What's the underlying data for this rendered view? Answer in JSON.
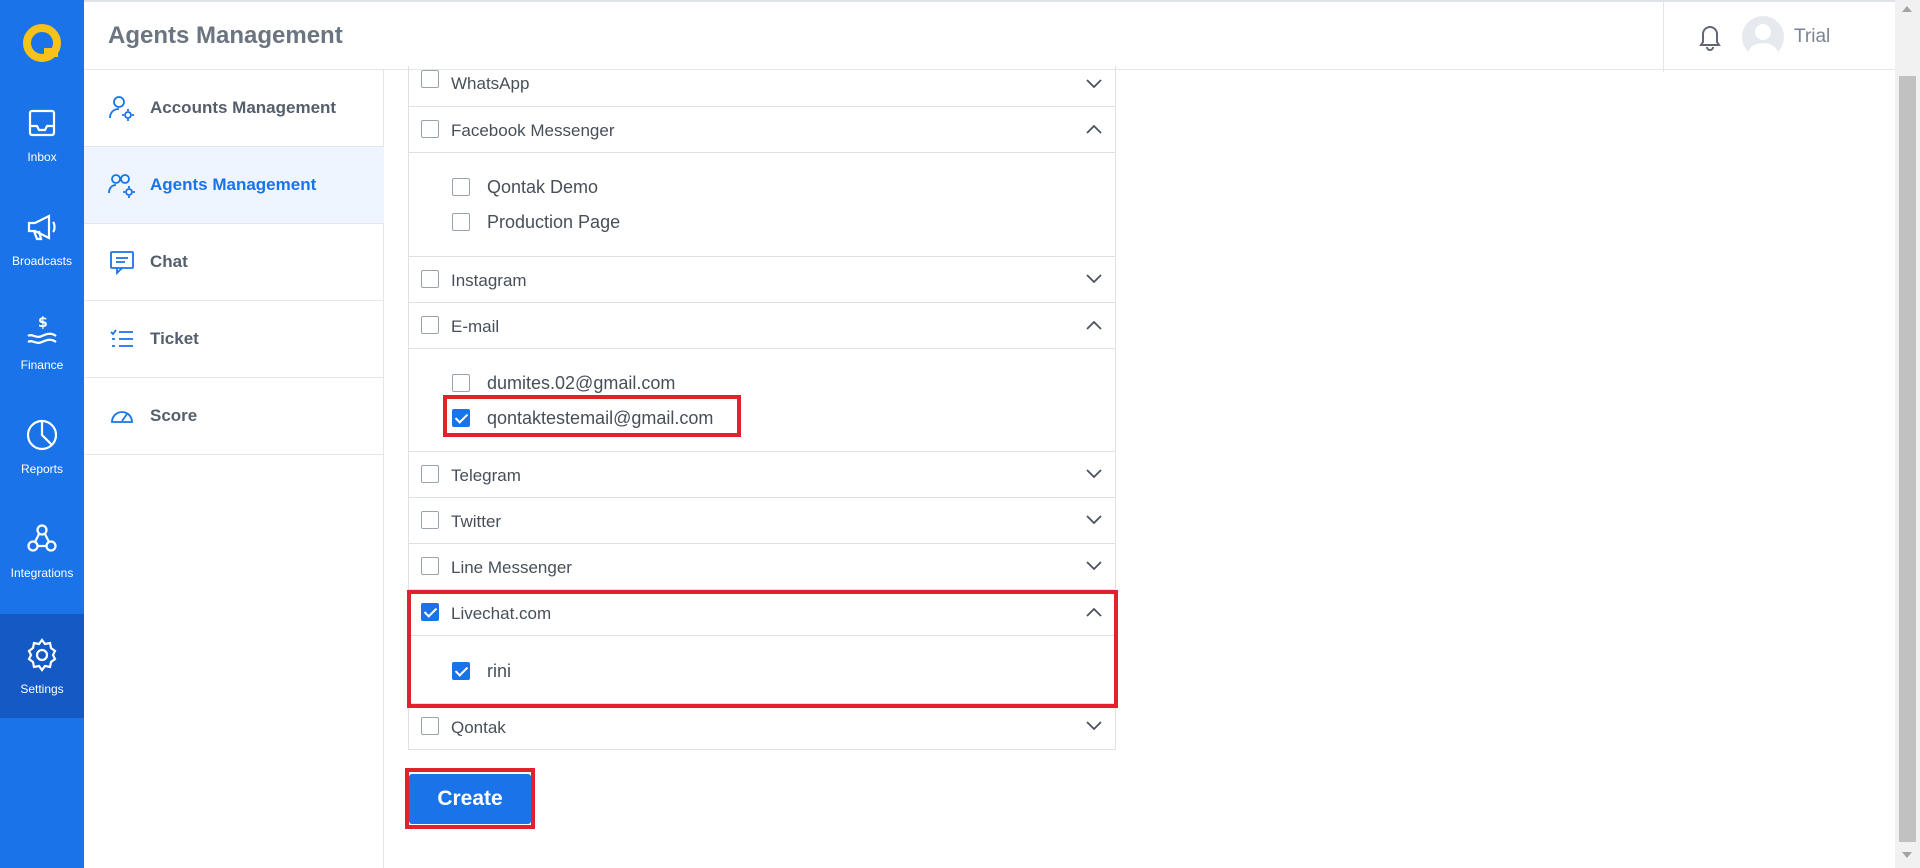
{
  "app": {
    "title": "Agents Management",
    "user_name": "Trial"
  },
  "colors": {
    "primary": "#1a73e8",
    "highlight": "#e0212e"
  },
  "rail": [
    {
      "label": "Inbox",
      "icon": "inbox-icon"
    },
    {
      "label": "Broadcasts",
      "icon": "megaphone-icon"
    },
    {
      "label": "Finance",
      "icon": "finance-icon"
    },
    {
      "label": "Reports",
      "icon": "pie-chart-icon"
    },
    {
      "label": "Integrations",
      "icon": "integrations-icon"
    },
    {
      "label": "Settings",
      "icon": "gear-icon",
      "active": true
    }
  ],
  "subnav": [
    {
      "label": "Accounts Management",
      "icon": "user-gear-icon"
    },
    {
      "label": "Agents Management",
      "icon": "users-gear-icon",
      "active": true
    },
    {
      "label": "Chat",
      "icon": "chat-icon"
    },
    {
      "label": "Ticket",
      "icon": "ticket-list-icon"
    },
    {
      "label": "Score",
      "icon": "gauge-icon"
    }
  ],
  "channels": [
    {
      "label": "WhatsApp",
      "checked": false,
      "expanded": false
    },
    {
      "label": "Facebook Messenger",
      "checked": false,
      "expanded": true,
      "items": [
        {
          "label": "Qontak Demo",
          "checked": false
        },
        {
          "label": "Production Page",
          "checked": false
        }
      ]
    },
    {
      "label": "Instagram",
      "checked": false,
      "expanded": false
    },
    {
      "label": "E-mail",
      "checked": false,
      "expanded": true,
      "items": [
        {
          "label": "dumites.02@gmail.com",
          "checked": false
        },
        {
          "label": "qontaktestemail@gmail.com",
          "checked": true
        }
      ]
    },
    {
      "label": "Telegram",
      "checked": false,
      "expanded": false
    },
    {
      "label": "Twitter",
      "checked": false,
      "expanded": false
    },
    {
      "label": "Line Messenger",
      "checked": false,
      "expanded": false
    },
    {
      "label": "Livechat.com",
      "checked": true,
      "expanded": true,
      "items": [
        {
          "label": "rini",
          "checked": true
        }
      ]
    },
    {
      "label": "Qontak",
      "checked": false,
      "expanded": false
    }
  ],
  "actions": {
    "create_label": "Create"
  }
}
